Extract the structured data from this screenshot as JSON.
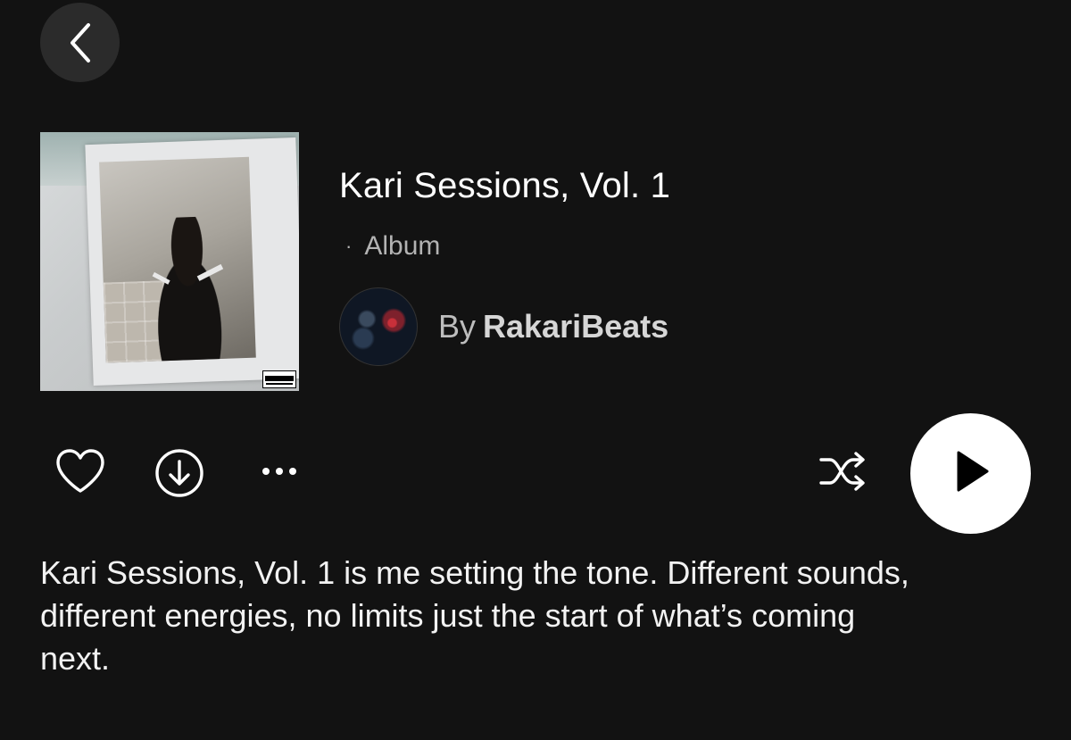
{
  "header": {
    "back_icon": "chevron-left-icon"
  },
  "album": {
    "title": "Kari Sessions, Vol. 1",
    "separator": "·",
    "type_label": "Album",
    "by_prefix": "By",
    "artist": "RakariBeats",
    "cover_badge": "PARENTAL ADVISORY EXPLICIT CONTENT"
  },
  "actions": {
    "like_icon": "heart-icon",
    "download_icon": "download-circle-icon",
    "more_icon": "more-dots-icon",
    "shuffle_icon": "shuffle-icon",
    "play_icon": "play-icon"
  },
  "description": "Kari Sessions, Vol. 1 is me setting the tone. Different sounds, different energies, no limits just the start of what’s coming next.",
  "colors": {
    "background": "#121212",
    "primary_text": "#ffffff",
    "secondary_text": "#b3b3b3",
    "play_button": "#ffffff"
  }
}
